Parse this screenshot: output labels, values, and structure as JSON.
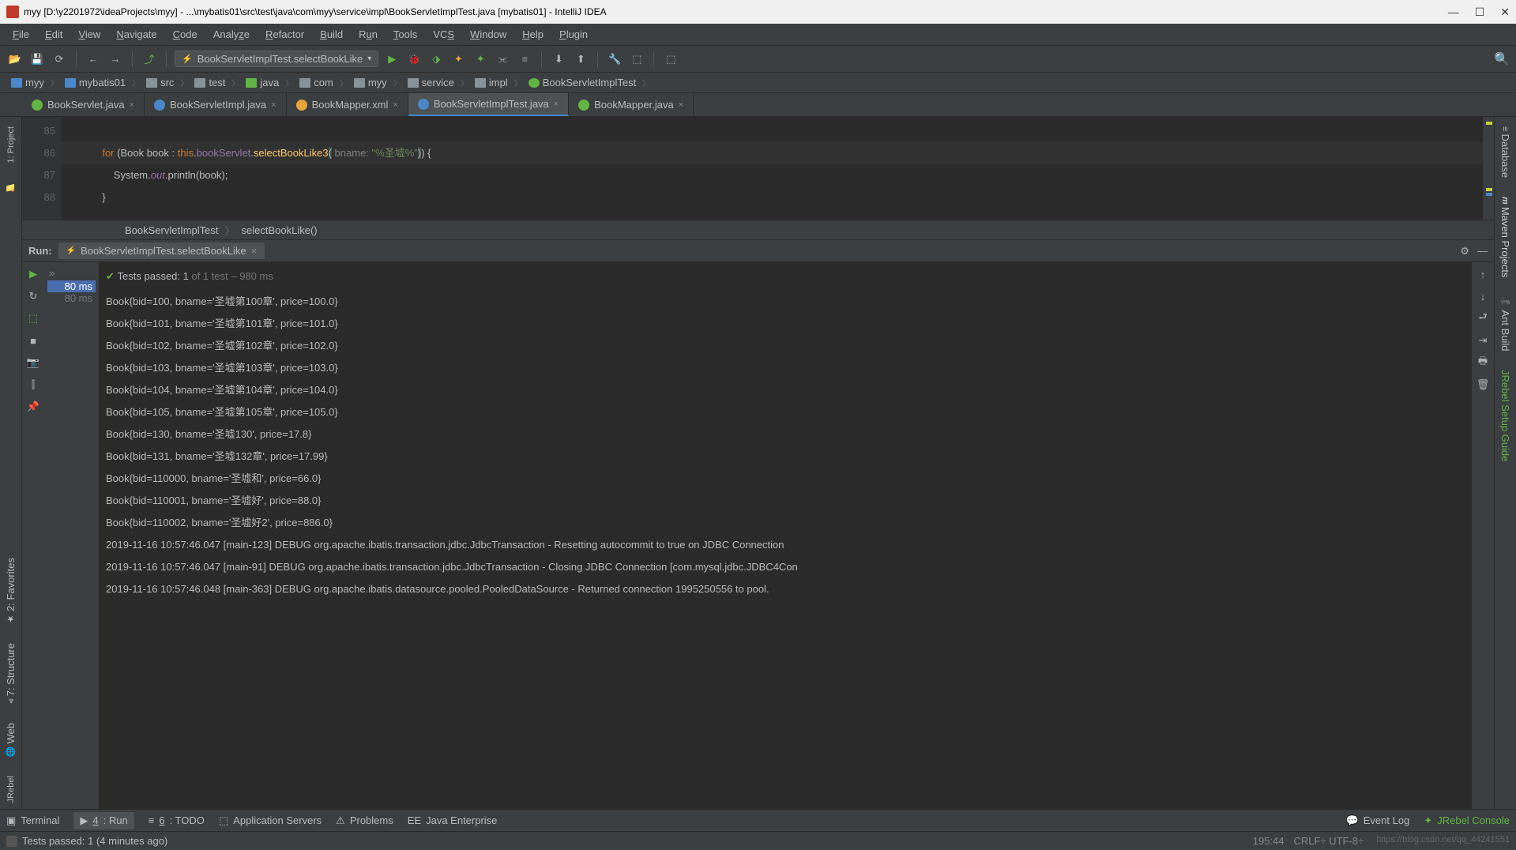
{
  "window": {
    "title": "myy [D:\\y2201972\\ideaProjects\\myy] - ...\\mybatis01\\src\\test\\java\\com\\myy\\service\\impl\\BookServletImplTest.java [mybatis01] - IntelliJ IDEA"
  },
  "menu": {
    "file": "File",
    "edit": "Edit",
    "view": "View",
    "navigate": "Navigate",
    "code": "Code",
    "analyze": "Analyze",
    "refactor": "Refactor",
    "build": "Build",
    "run": "Run",
    "tools": "Tools",
    "vcs": "VCS",
    "window": "Window",
    "help": "Help",
    "plugin": "Plugin"
  },
  "toolbar": {
    "config": "BookServletImplTest.selectBookLike"
  },
  "breadcrumb": {
    "items": [
      "myy",
      "mybatis01",
      "src",
      "test",
      "java",
      "com",
      "myy",
      "service",
      "impl",
      "BookServletImplTest"
    ]
  },
  "tabs": {
    "t0": "BookServlet.java",
    "t1": "BookServletImpl.java",
    "t2": "BookMapper.xml",
    "t3": "BookServletImplTest.java",
    "t4": "BookMapper.java"
  },
  "editor": {
    "lines": {
      "l85": "85",
      "l86": "86",
      "l87": "87",
      "l88": "88"
    },
    "kw_for": "for",
    "type_book": "Book",
    "var_book": "book",
    "kw_this": "this",
    "field": "bookServlet",
    "method": "selectBookLike3",
    "param_hint": " bname: ",
    "str": "\"%圣墟%\"",
    "sys": "System.",
    "out": "out",
    "println": ".println(book);",
    "crumb1": "BookServletImplTest",
    "crumb2": "selectBookLike()"
  },
  "run": {
    "label": "Run:",
    "tab": "BookServletImplTest.selectBookLike",
    "tests_prefix": "Tests passed: 1",
    "tests_mid": " of 1 test",
    "tests_time": " – 980 ms",
    "tree_time1": "80 ms",
    "tree_time2": "80 ms",
    "console": [
      "Book{bid=100, bname='圣墟第100章', price=100.0}",
      "Book{bid=101, bname='圣墟第101章', price=101.0}",
      "Book{bid=102, bname='圣墟第102章', price=102.0}",
      "Book{bid=103, bname='圣墟第103章', price=103.0}",
      "Book{bid=104, bname='圣墟第104章', price=104.0}",
      "Book{bid=105, bname='圣墟第105章', price=105.0}",
      "Book{bid=130, bname='圣墟130', price=17.8}",
      "Book{bid=131, bname='圣墟132章', price=17.99}",
      "Book{bid=110000, bname='圣墟和', price=66.0}",
      "Book{bid=110001, bname='圣墟好', price=88.0}",
      "Book{bid=110002, bname='圣墟好2', price=886.0}",
      "2019-11-16 10:57:46.047 [main-123] DEBUG org.apache.ibatis.transaction.jdbc.JdbcTransaction - Resetting autocommit to true on JDBC Connection",
      "2019-11-16 10:57:46.047 [main-91] DEBUG org.apache.ibatis.transaction.jdbc.JdbcTransaction - Closing JDBC Connection [com.mysql.jdbc.JDBC4Con",
      "2019-11-16 10:57:46.048 [main-363] DEBUG org.apache.ibatis.datasource.pooled.PooledDataSource - Returned connection 1995250556 to pool."
    ]
  },
  "bottombar": {
    "terminal": "Terminal",
    "run": "4: Run",
    "todo": "6: TODO",
    "appservers": "Application Servers",
    "problems": "Problems",
    "javaee": "Java Enterprise",
    "eventlog": "Event Log",
    "jrebel": "JRebel Console"
  },
  "left": {
    "project": "1: Project",
    "favorites": "2: Favorites",
    "structure": "7: Structure",
    "web": "Web",
    "jrebel": "JRebel"
  },
  "right": {
    "database": "Database",
    "maven": "Maven Projects",
    "ant": "Ant Build",
    "jrebel": "JRebel Setup Guide"
  },
  "status": {
    "msg": "Tests passed: 1 (4 minutes ago)",
    "pos": "195:44",
    "enc": "CRLF÷  UTF-8÷",
    "watermark": "https://blog.csdn.net/qq_44241551"
  }
}
